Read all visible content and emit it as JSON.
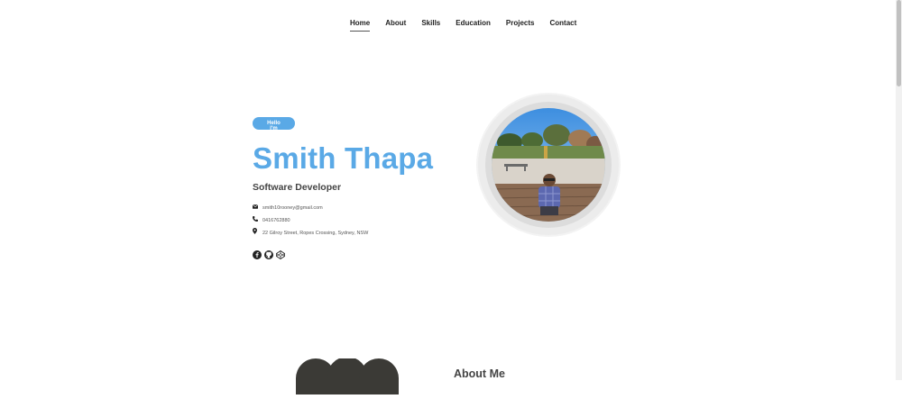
{
  "nav": {
    "items": [
      {
        "label": "Home",
        "active": true
      },
      {
        "label": "About",
        "active": false
      },
      {
        "label": "Skills",
        "active": false
      },
      {
        "label": "Education",
        "active": false
      },
      {
        "label": "Projects",
        "active": false
      },
      {
        "label": "Contact",
        "active": false
      }
    ]
  },
  "hero": {
    "badge": "Hello I'm",
    "name": "Smith Thapa",
    "role": "Software Developer",
    "contacts": [
      {
        "icon": "envelope-icon",
        "text": "smith10rooney@gmail.com"
      },
      {
        "icon": "phone-icon",
        "text": "0416762880"
      },
      {
        "icon": "map-marker-icon",
        "text": "22 Gilroy Street, Ropes Crossing, Sydney, NSW"
      }
    ],
    "socials": [
      "facebook-icon",
      "github-icon",
      "codepen-icon"
    ]
  },
  "about": {
    "title": "About Me"
  },
  "colors": {
    "accent": "#5aa9e6",
    "text": "#333333",
    "background": "#ffffff"
  }
}
